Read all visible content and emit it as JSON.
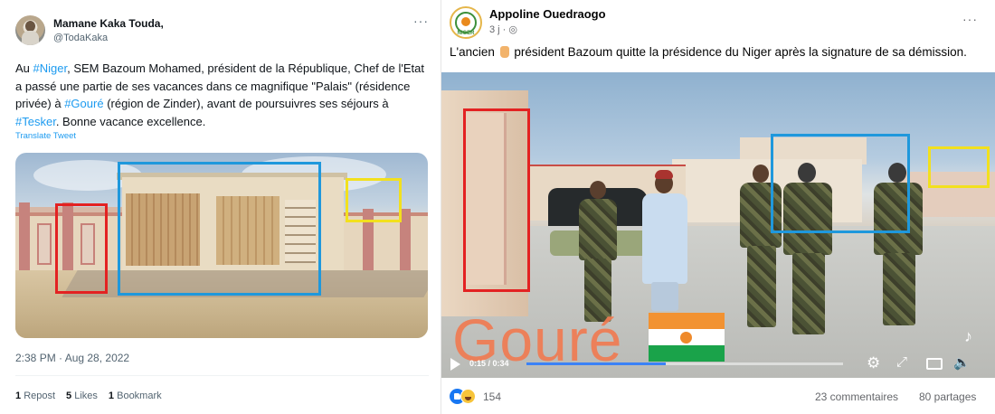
{
  "tweet": {
    "author_name": "Mamane Kaka Touda,",
    "handle": "@TodaKaka",
    "more": "···",
    "text_parts": {
      "p1": "Au ",
      "tag_niger": "#Niger",
      "p2": ", SEM Bazoum Mohamed, président de la République, Chef de l'Etat a passé une partie de ses vacances dans ce magnifique \"Palais\" (résidence privée) à ",
      "tag_goure": "#Gouré",
      "p3": " (région de Zinder), avant de poursuivres ses séjours à ",
      "tag_tesker": "#Tesker",
      "p4": ". Bonne vacance excellence."
    },
    "translate": "Translate Tweet",
    "timestamp": "2:38 PM · Aug 28, 2022",
    "stats": {
      "reposts_count": "1",
      "reposts_label": "Repost",
      "likes_count": "5",
      "likes_label": "Likes",
      "bookmarks_count": "1",
      "bookmarks_label": "Bookmark"
    }
  },
  "facebook": {
    "author_name": "Appoline Ouedraogo",
    "meta": "3 j · ",
    "globe_icon": "globe-icon",
    "avatar_label": "NIGER",
    "more": "···",
    "text_before": "L'ancien ",
    "text_after": "président Bazoum quitte la présidence du Niger après la signature de sa démission.",
    "video": {
      "overlay_text": "Gouré",
      "time": "0:15 / 0:34",
      "progress": 0.44,
      "watermark": "TikTok",
      "icons": [
        "play-icon",
        "gear-icon",
        "expand-icon",
        "pip-icon",
        "volume-icon"
      ]
    },
    "reactions_count": "154",
    "comments": "23 commentaires",
    "shares": "80 partages"
  },
  "colors": {
    "tweet_link": "#1d9bf0",
    "box_red": "#e32222",
    "box_blue": "#1f98dc",
    "box_yellow": "#f2e01e",
    "fb_blue": "#1877f2",
    "overlay_orange": "#f07b52"
  }
}
